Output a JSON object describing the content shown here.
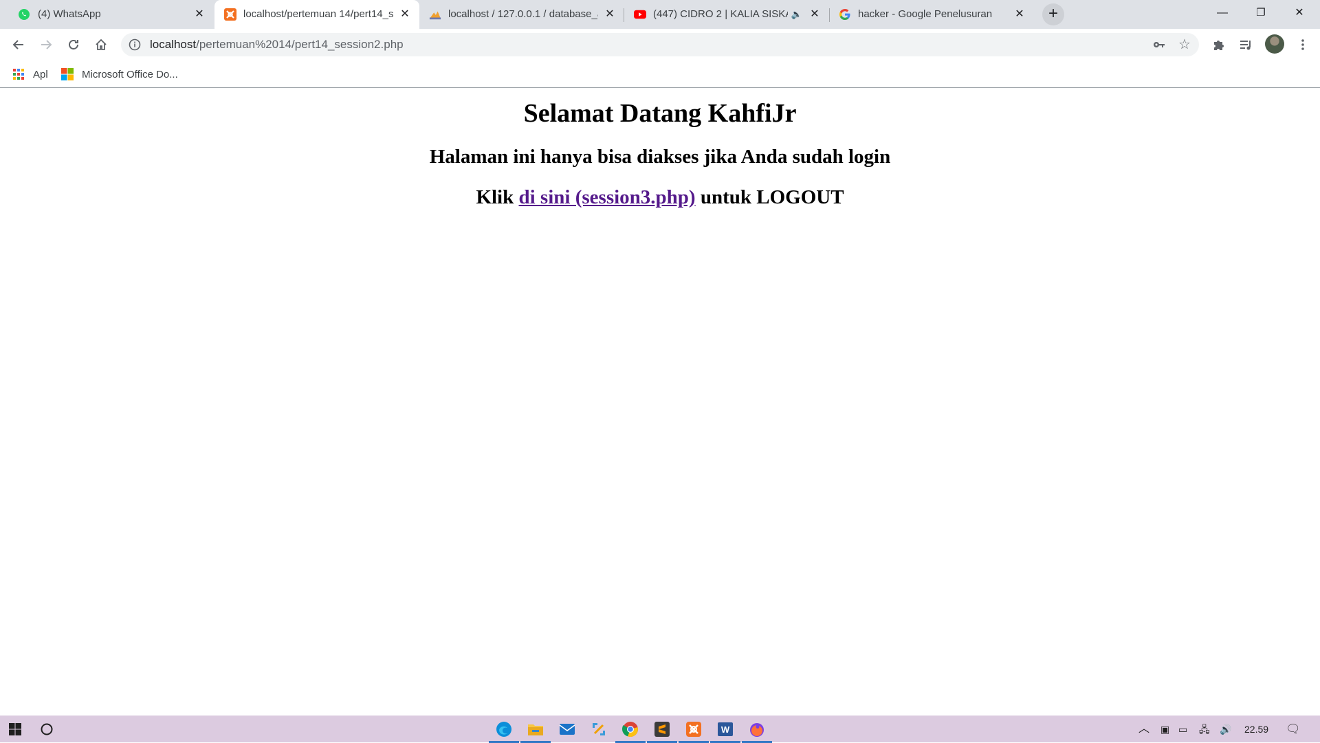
{
  "browser": {
    "tabs": [
      {
        "title": "(4) WhatsApp",
        "icon": "whatsapp-icon",
        "active": false
      },
      {
        "title": "localhost/pertemuan 14/pert14_s",
        "icon": "xampp-icon",
        "active": true
      },
      {
        "title": "localhost / 127.0.0.1 / database_a",
        "icon": "phpmyadmin-icon",
        "active": false
      },
      {
        "title": "(447) CIDRO 2 | KALIA SISKA",
        "icon": "youtube-icon",
        "active": false
      },
      {
        "title": "hacker - Google Penelusuran",
        "icon": "google-icon",
        "active": false
      }
    ],
    "new_tab": "+",
    "window_controls": {
      "minimize": "—",
      "restore": "❐",
      "close": "✕"
    },
    "address": {
      "host": "localhost",
      "path": "/pertemuan%2014/pert14_session2.php"
    },
    "bookmarks": [
      {
        "label": "Apl",
        "icon": "apps-grid-icon"
      },
      {
        "label": "Microsoft Office Do...",
        "icon": "microsoft-logo-icon"
      }
    ]
  },
  "page": {
    "heading": "Selamat Datang KahfiJr",
    "subheading": "Halaman ini hanya bisa diakses jika Anda sudah login",
    "logout_prefix": "Klik",
    "logout_link": "di sini (session3.php)",
    "logout_suffix": "untuk LOGOUT"
  },
  "taskbar": {
    "clock": "22.59",
    "apps": [
      "edge-icon",
      "file-explorer-icon",
      "mail-icon",
      "snip-sketch-icon",
      "chrome-icon",
      "sublime-text-icon",
      "xampp-icon",
      "word-icon",
      "firefox-icon"
    ]
  },
  "colors": {
    "tabstrip": "#dee1e6",
    "link_visited": "#551a8b",
    "taskbar": "#dccbe0",
    "taskbar_indicator": "#3478c6"
  }
}
